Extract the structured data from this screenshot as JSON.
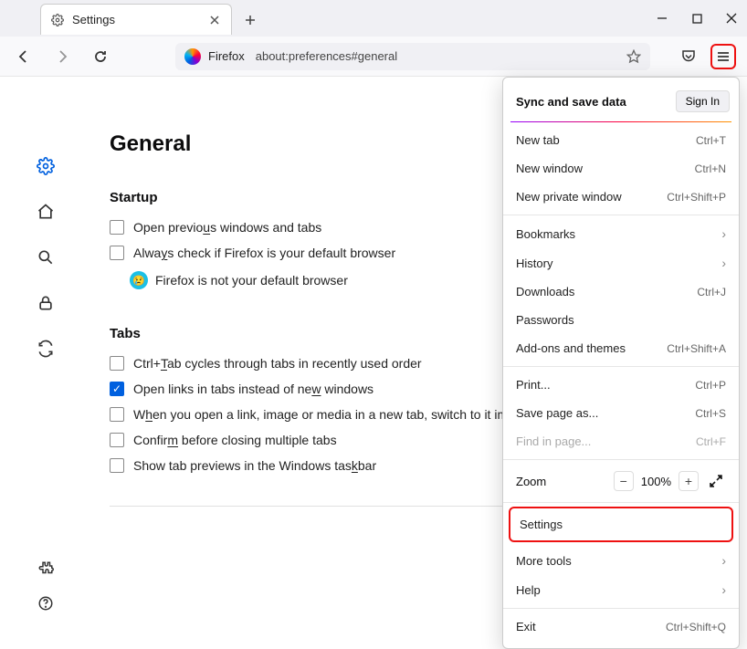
{
  "window": {
    "tab_title": "Settings"
  },
  "toolbar": {
    "url_label": "Firefox",
    "url": "about:preferences#general"
  },
  "page": {
    "heading": "General",
    "startup": {
      "title": "Startup",
      "open_previous_pre": "Open previo",
      "open_previous_u": "u",
      "open_previous_post": "s windows and tabs",
      "always_pre": "Alwa",
      "always_u": "y",
      "always_post": "s check if Firefox is your default browser",
      "not_default": "Firefox is not your default browser"
    },
    "tabs": {
      "title": "Tabs",
      "ctrl_pre": "Ctrl+",
      "ctrl_u": "T",
      "ctrl_post": "ab cycles through tabs in recently used order",
      "open_links_pre": "Open links in tabs instead of ne",
      "open_links_u": "w",
      "open_links_post": " windows",
      "switch_pre": "W",
      "switch_u": "h",
      "switch_post": "en you open a link, image or media in a new tab, switch to it immediately",
      "confirm_pre": "Confir",
      "confirm_u": "m",
      "confirm_post": " before closing multiple tabs",
      "taskbar_pre": "Show tab previews in the Windows tas",
      "taskbar_u": "k",
      "taskbar_post": "bar"
    }
  },
  "appmenu": {
    "sync_title": "Sync and save data",
    "signin": "Sign In",
    "new_tab": {
      "label": "New tab",
      "short": "Ctrl+T"
    },
    "new_window": {
      "label": "New window",
      "short": "Ctrl+N"
    },
    "new_private": {
      "label": "New private window",
      "short": "Ctrl+Shift+P"
    },
    "bookmarks": {
      "label": "Bookmarks"
    },
    "history": {
      "label": "History"
    },
    "downloads": {
      "label": "Downloads",
      "short": "Ctrl+J"
    },
    "passwords": {
      "label": "Passwords"
    },
    "addons": {
      "label": "Add-ons and themes",
      "short": "Ctrl+Shift+A"
    },
    "print": {
      "label": "Print...",
      "short": "Ctrl+P"
    },
    "save_as": {
      "label": "Save page as...",
      "short": "Ctrl+S"
    },
    "find": {
      "label": "Find in page...",
      "short": "Ctrl+F"
    },
    "zoom": {
      "label": "Zoom",
      "value": "100%"
    },
    "settings": {
      "label": "Settings"
    },
    "more_tools": {
      "label": "More tools"
    },
    "help": {
      "label": "Help"
    },
    "exit": {
      "label": "Exit",
      "short": "Ctrl+Shift+Q"
    }
  }
}
